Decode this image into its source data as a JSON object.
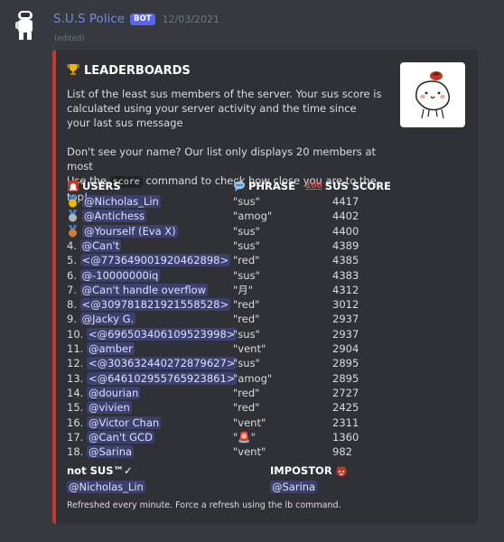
{
  "message": {
    "author": "S.U.S Police",
    "badge": "BOT",
    "timestamp": "12/03/2021",
    "edited": "(edited)"
  },
  "embed": {
    "accent_color": "#c0392b",
    "title": "LEADERBOARDS",
    "title_icon": "trophy-icon",
    "desc_line1": "List of the least sus members of the server. Your sus score is calculated using your server activity and the time since your last sus message",
    "desc_line2": "Don't see your name? Our list only displays 20 members at most",
    "desc_line3_pre": "Use the",
    "desc_line3_cmd": "score",
    "desc_line3_post": "command to check how close you are to the top!",
    "columns": {
      "users": "USERS",
      "phrase": "PHRASE",
      "score": "SUS SCORE"
    },
    "rows": [
      {
        "rank": "",
        "medal": "gold",
        "user": "@Nicholas_Lin",
        "phrase": "\"sus\"",
        "score": "4417"
      },
      {
        "rank": "",
        "medal": "silver",
        "user": "@Antichess",
        "phrase": "\"amog\"",
        "score": "4402"
      },
      {
        "rank": "",
        "medal": "bronze",
        "user": "@Yourself (Eva X)",
        "phrase": "\"sus\"",
        "score": "4400"
      },
      {
        "rank": "4.",
        "medal": "",
        "user": "@Can't",
        "phrase": "\"sus\"",
        "score": "4389"
      },
      {
        "rank": "5.",
        "medal": "",
        "user": "<@773649001920462898>",
        "phrase": "\"red\"",
        "score": "4385"
      },
      {
        "rank": "6.",
        "medal": "",
        "user": "@-10000000iq",
        "phrase": "\"sus\"",
        "score": "4383"
      },
      {
        "rank": "7.",
        "medal": "",
        "user": "@Can't handle overflow",
        "phrase": "\"月\"",
        "score": "4312"
      },
      {
        "rank": "8.",
        "medal": "",
        "user": "<@309781821921558528>",
        "phrase": "\"red\"",
        "score": "3012"
      },
      {
        "rank": "9.",
        "medal": "",
        "user": "@Jacky G.",
        "phrase": "\"red\"",
        "score": "2937"
      },
      {
        "rank": "10.",
        "medal": "",
        "user": "<@696503406109523998>",
        "phrase": "\"sus\"",
        "score": "2937"
      },
      {
        "rank": "11.",
        "medal": "",
        "user": "@amber",
        "phrase": "\"vent\"",
        "score": "2904"
      },
      {
        "rank": "12.",
        "medal": "",
        "user": "<@303632440272879627>",
        "phrase": "\"sus\"",
        "score": "2895"
      },
      {
        "rank": "13.",
        "medal": "",
        "user": "<@646102955765923861>",
        "phrase": "\"amog\"",
        "score": "2895"
      },
      {
        "rank": "14.",
        "medal": "",
        "user": "@dourian",
        "phrase": "\"red\"",
        "score": "2727"
      },
      {
        "rank": "15.",
        "medal": "",
        "user": "@vivien",
        "phrase": "\"red\"",
        "score": "2425"
      },
      {
        "rank": "16.",
        "medal": "",
        "user": "@Victor Chan",
        "phrase": "\"vent\"",
        "score": "2311"
      },
      {
        "rank": "17.",
        "medal": "",
        "user": "@Can't GCD",
        "phrase": "\"🚨\"",
        "score": "1360"
      },
      {
        "rank": "18.",
        "medal": "",
        "user": "@Sarina",
        "phrase": "\"vent\"",
        "score": "982"
      }
    ],
    "not_sus": {
      "name": "not SUS™✓",
      "value": "@Nicholas_Lin"
    },
    "impostor": {
      "name": "IMPOSTOR",
      "value": "@Sarina"
    },
    "footer": "Refreshed every minute. Force a refresh using the lb command."
  }
}
